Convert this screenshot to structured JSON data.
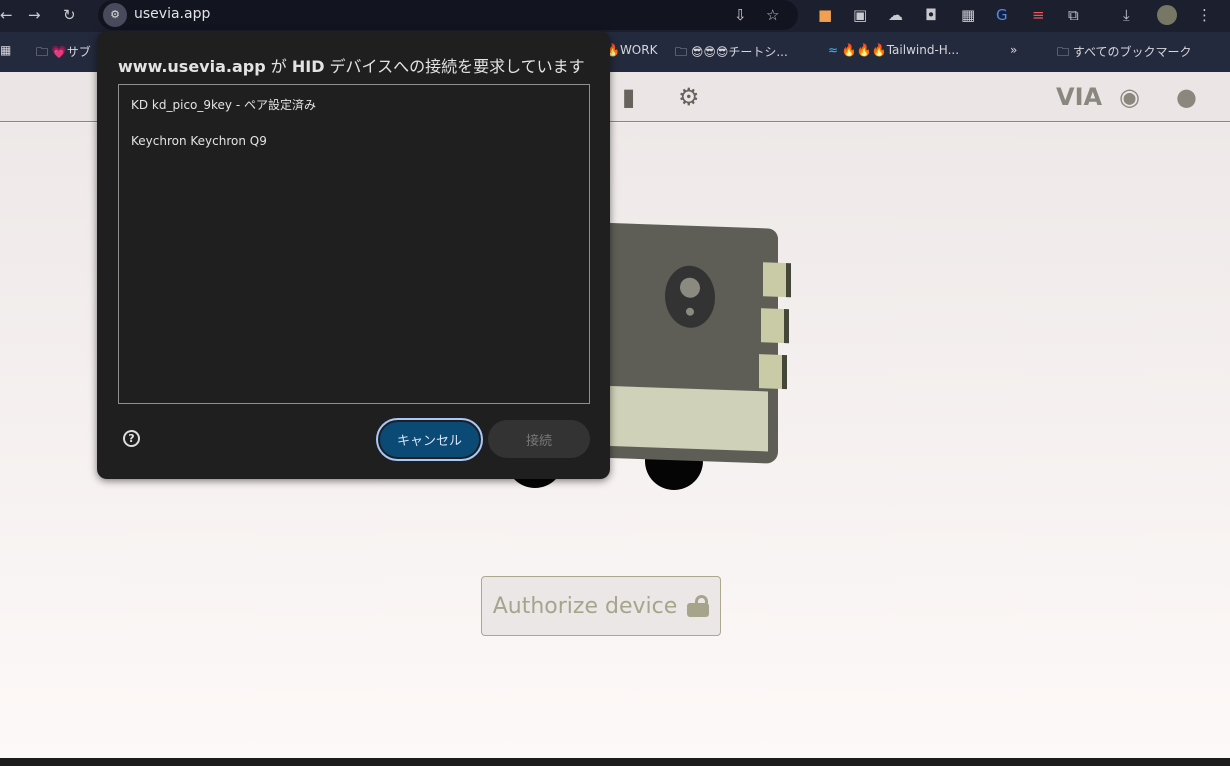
{
  "browser": {
    "url": "usevia.app",
    "bookmarks": [
      "💗サブ",
      "🔥WORK",
      "😎😎😎チートシ...",
      "🔥🔥🔥Tailwind-H..."
    ],
    "all_bookmarks": "すべてのブックマーク",
    "overflow": "»"
  },
  "app": {
    "header_right": {
      "via_logo": "VIA"
    },
    "authorize_label": "Authorize device"
  },
  "dialog": {
    "site": "www.usevia.app",
    "title_mid": " が ",
    "title_hid": "HID",
    "title_rest": " デバイスへの接続を要求しています",
    "devices": [
      "KD kd_pico_9key - ペア設定済み",
      "Keychron Keychron Q9"
    ],
    "cancel_label": "キャンセル",
    "connect_label": "接続",
    "help": "?"
  },
  "colors": {
    "accent": "#0b4a75",
    "focus": "#a8c7fa",
    "app_muted": "#a6a58c"
  }
}
